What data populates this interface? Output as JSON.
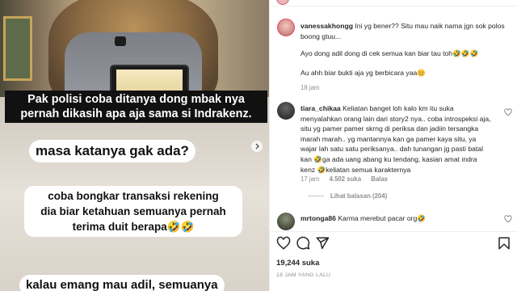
{
  "media": {
    "captions": {
      "dark_line1": "Pak polisi coba ditanya dong mbak nya",
      "dark_line2": "pernah dikasih apa aja sama si Indrakenz.",
      "c1": "masa katanya gak ada?",
      "c2_line1": "coba bongkar transaksi rekening",
      "c2_line2": "dia biar ketahuan semuanya pernah",
      "c2_line3": "terima duit berapa🤣🤣",
      "c3": "kalau emang mau adil, semuanya"
    }
  },
  "comments": [
    {
      "username": "vanessakhongg",
      "lines": [
        "Ini yg bener?? Situ mau naik nama jgn sok polos",
        "boong gtuu...",
        "",
        "Ayo dong adil dong di cek semua kan biar tau toh🤣🤣🤣",
        "",
        "Au ahh biar bukti aja yg berbicara yaa😊"
      ],
      "time": "18 jam"
    },
    {
      "username": "tiara_chikaa",
      "lines": [
        "Keliatan banget loh kalo km itu suka",
        "menyalahkan orang lain dari story2 nya.. coba introspeksi aja,",
        "situ yg pamer pamer skrng di periksa dan jadiin tersangka",
        "marah marah.. yg mantannya kan ga pamer kaya situ, ya",
        "wajar lah satu satu periksanya.. dah tunangan jg pasti batal",
        "kan 🤣ga ada uang abang ku tendang, kasian amat indra",
        "kenz 🤣keliatan semua karakternya"
      ],
      "time": "17 jam",
      "likes": "4.502 suka",
      "reply": "Balas",
      "view_replies": "Lihat balasan (204)"
    },
    {
      "username": "mrtonga86",
      "text": "Karma merebut pacar org🤣"
    }
  ],
  "post": {
    "likes": "19,244 suka",
    "time_ago": "18 JAM YANG LALU"
  },
  "icons": [
    "heart-icon",
    "comment-icon",
    "share-icon",
    "bookmark-icon"
  ]
}
